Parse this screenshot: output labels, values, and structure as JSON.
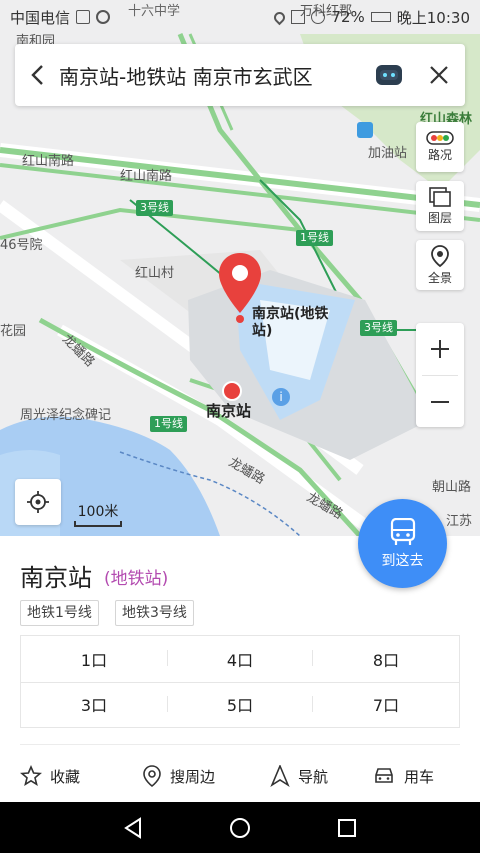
{
  "status_bar": {
    "carrier": "中国电信",
    "battery": "72%",
    "time": "晚上10:30"
  },
  "search": {
    "query": "南京站-地铁站 南京市玄武区"
  },
  "map": {
    "labels": {
      "shizhong": "十六中学",
      "nanhe": "南和园",
      "hongshan_road_left": "红山南路",
      "hongshan_road_mid": "红山南路",
      "hao_yuan": "46号院",
      "hongshan_village": "红山村",
      "huayuan": "花园",
      "jiayouzhan": "加油站",
      "hongshan_forest": "红山森林",
      "station_main": "南京站(地铁站)",
      "station_south": "南京站",
      "longpan_road_left": "龙蟠路",
      "longpan_road_right": "龙蟠路",
      "longpan_road_bottom": "龙蟠路",
      "monument": "周光泽纪念碑记",
      "jiangsu": "江苏",
      "chaoshan": "朝山路",
      "wanyu": "万科红郡"
    },
    "line_badges": {
      "line3_top": "3号线",
      "line1_top": "1号线",
      "line3_right": "3号线",
      "line1_bottom": "1号线"
    },
    "scale": "100米"
  },
  "tools": {
    "traffic": "路况",
    "layers": "图层",
    "panorama": "全景"
  },
  "go_button": "到这去",
  "place": {
    "name": "南京站",
    "type": "(地铁站)",
    "tags": [
      "地铁1号线",
      "地铁3号线"
    ],
    "exits": [
      "1口",
      "4口",
      "8口",
      "3口",
      "5口",
      "7口"
    ]
  },
  "actions": {
    "favorite": "收藏",
    "nearby": "搜周边",
    "navigate": "导航",
    "car": "用车"
  },
  "colors": {
    "accent_blue": "#3e8ef7",
    "metro_green": "#2e9e57",
    "pin_red": "#e8413d",
    "type_purple": "#b34bb0"
  }
}
